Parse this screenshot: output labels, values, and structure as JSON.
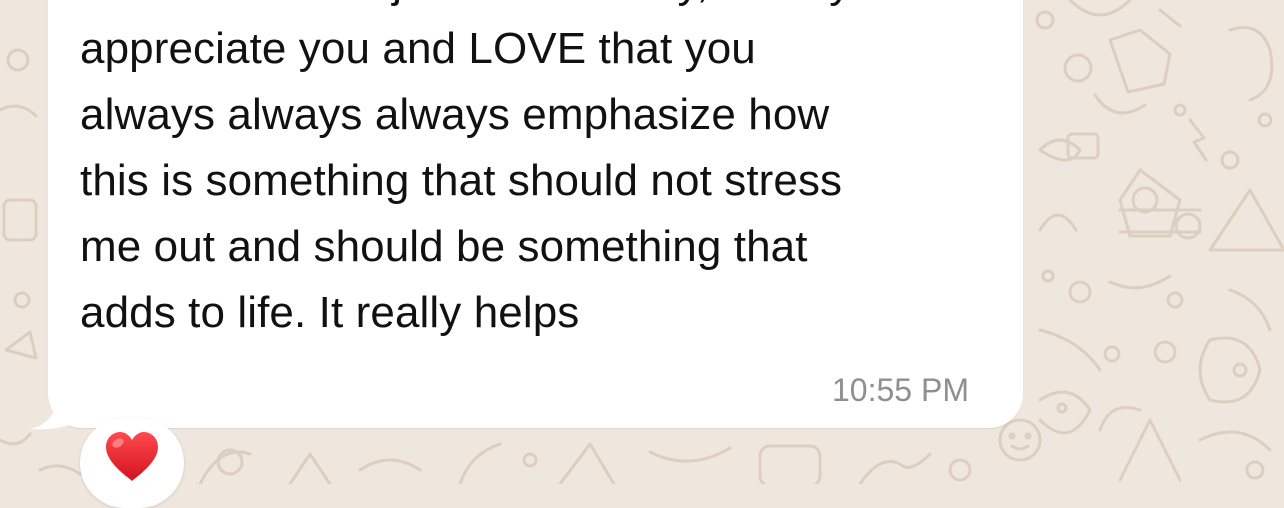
{
  "message": {
    "text": "fitness. Which I just have to say, I really\nappreciate you and LOVE that you\nalways always always emphasize how\nthis is something that should not stress\nme out and should be something that\nadds to life. It really helps",
    "time": "10:55 PM"
  },
  "reaction": {
    "emoji": "❤️",
    "icon": "red-heart-icon"
  },
  "colors": {
    "wallpaper": "#efe7dd",
    "doodle": "#d9cdbd",
    "bubble": "#ffffff",
    "text": "#111111",
    "timestamp": "#8e8e93",
    "heart": "#e0232e"
  }
}
